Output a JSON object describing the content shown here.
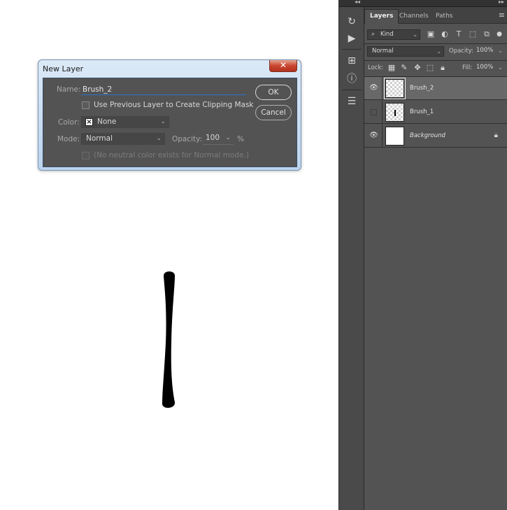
{
  "dialog": {
    "title": "New Layer",
    "close_glyph": "✕",
    "name_label": "Name:",
    "name_value": "Brush_2",
    "ok_label": "OK",
    "cancel_label": "Cancel",
    "clipping_label": "Use Previous Layer to Create Clipping Mask",
    "color_label": "Color:",
    "color_value": "None",
    "mode_label": "Mode:",
    "mode_value": "Normal",
    "opacity_label": "Opacity:",
    "opacity_value": "100",
    "opacity_unit": "%",
    "neutral_label": "(No neutral color exists for Normal mode.)"
  },
  "toolstrip": {
    "collapse_glyph": "◂◂",
    "expand_glyph": "▸▸",
    "tools": [
      {
        "name": "history-icon",
        "glyph": "↻"
      },
      {
        "name": "play-actions-icon",
        "glyph": "▶"
      },
      {
        "name": "adjustments-icon",
        "glyph": "⊞"
      },
      {
        "name": "info-icon",
        "glyph": "ⓘ"
      },
      {
        "name": "clone-source-icon",
        "glyph": "☰"
      }
    ]
  },
  "layers_panel": {
    "tabs": [
      "Layers",
      "Channels",
      "Paths"
    ],
    "active_tab": "Layers",
    "menu_glyph": "≡",
    "filter": {
      "search_glyph": "⌕",
      "kind_label": "Kind"
    },
    "blend_mode": "Normal",
    "opacity_label": "Opacity:",
    "opacity_value": "100%",
    "lock_label": "Lock:",
    "fill_label": "Fill:",
    "fill_value": "100%",
    "layers": [
      {
        "name": "Brush_2",
        "visible": true,
        "selected": true,
        "thumb": "transparent"
      },
      {
        "name": "Brush_1",
        "visible": false,
        "selected": false,
        "thumb": "transparent"
      },
      {
        "name": "Background",
        "visible": true,
        "selected": false,
        "thumb": "white",
        "locked": true
      }
    ]
  },
  "colors": {
    "panel_bg": "#535353",
    "accent_blue": "#2f6fc7",
    "close_red": "#c84530"
  }
}
